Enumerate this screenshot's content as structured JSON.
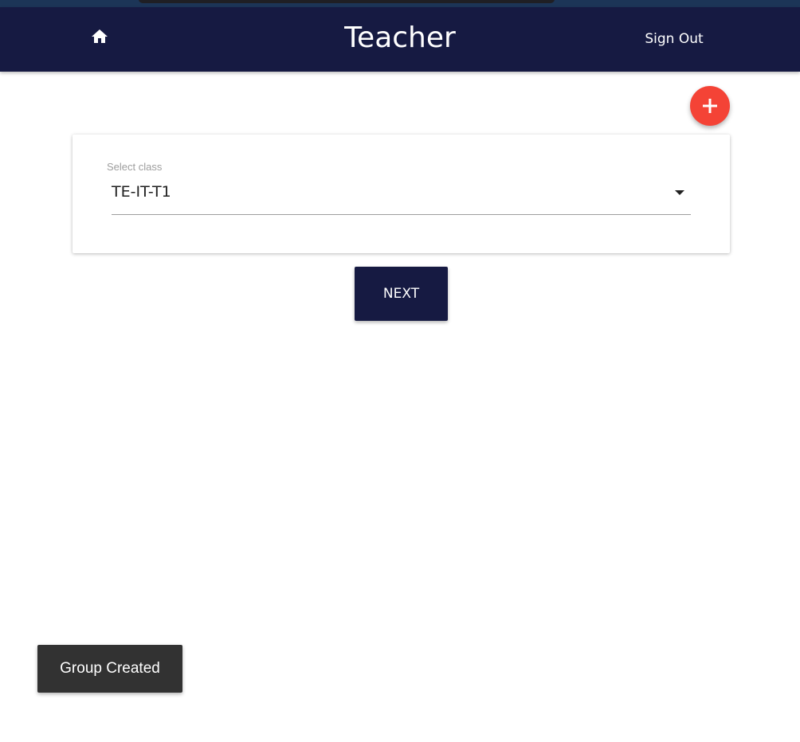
{
  "header": {
    "title": "Teacher",
    "sign_out_label": "Sign Out",
    "home_icon": "home-icon",
    "background_color": "#161a42"
  },
  "fab": {
    "icon": "plus-icon",
    "color": "#f44336"
  },
  "class_select": {
    "label": "Select class",
    "selected_value": "TE-IT-T1",
    "icon": "caret-down-icon"
  },
  "next_button": {
    "label": "NEXT"
  },
  "toast": {
    "message": "Group Created"
  }
}
